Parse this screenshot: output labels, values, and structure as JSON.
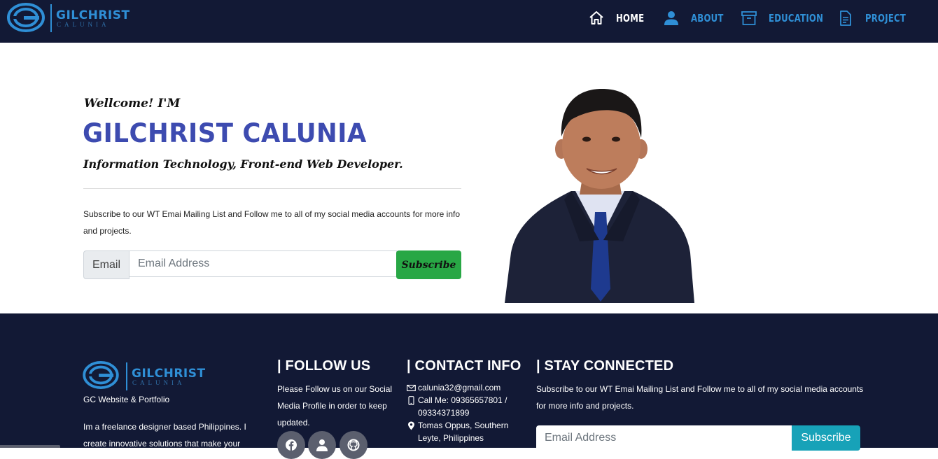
{
  "navbar": {
    "brand": {
      "name": "GILCHRIST",
      "sub": "CALUNIA"
    },
    "items": [
      {
        "label": "HOME",
        "icon": "home-icon",
        "active": true
      },
      {
        "label": "ABOUT",
        "icon": "user-icon"
      },
      {
        "label": "EDUCATION",
        "icon": "archive-icon"
      },
      {
        "label": "PROJECT",
        "icon": "document-icon"
      }
    ]
  },
  "hero": {
    "welcome": "Wellcome! I'M",
    "name": "GILCHRIST CALUNIA",
    "role": "Information Technology, Front-end Web Developer.",
    "text": "Subscribe to our WT Emai Mailing List and Follow me to all of my social media accounts for more info and projects.",
    "form": {
      "prefix": "Email",
      "placeholder": "Email Address",
      "button": "Subscribe"
    }
  },
  "footer": {
    "brand": {
      "name": "GILCHRIST",
      "sub": "CALUNIA"
    },
    "tagline": "GC Website & Portfolio",
    "about": "Im a freelance designer based Philippines. I create innovative solutions that make your",
    "follow": {
      "heading": "| FOLLOW US",
      "text": "Please Follow us on our Social Media Profile in order to keep updated.",
      "icons": [
        "facebook-icon",
        "user-icon",
        "github-icon"
      ]
    },
    "contact": {
      "heading": "| CONTACT INFO",
      "email": "calunia32@gmail.com",
      "phone": "Call Me: 09365657801 / 09334371899",
      "address": "Tomas Oppus, Southern Leyte, Philippines"
    },
    "stay": {
      "heading": "| STAY CONNECTED",
      "text": "Subscribe to our WT Emai Mailing List and Follow me to all of my social media accounts for more info and projects.",
      "placeholder": "Email Address",
      "button": "Subscribe"
    }
  },
  "colors": {
    "navy": "#121935",
    "accent_blue": "#2f8fd6",
    "name_blue": "#3d4bb0",
    "subscribe_green": "#28a745",
    "subscribe_teal": "#17a2b8"
  }
}
